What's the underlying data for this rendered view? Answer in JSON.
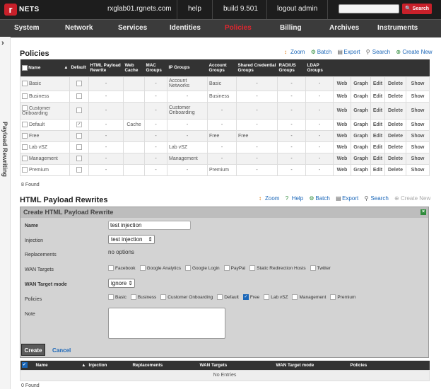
{
  "topbar": {
    "logo_letter": "r",
    "logo_text": "NETS",
    "host": "rxglab01.rgnets.com",
    "help": "help",
    "build": "build 9.501",
    "logout": "logout admin",
    "search_placeholder": "",
    "search_button": "Search"
  },
  "nav": [
    "System",
    "Network",
    "Services",
    "Identities",
    "Policies",
    "Billing",
    "Archives",
    "Instruments"
  ],
  "nav_active": "Policies",
  "sidebar": {
    "toggle": "›",
    "label": "Payload Rewriting"
  },
  "policies": {
    "title": "Policies",
    "actions": {
      "zoom": "Zoom",
      "batch": "Batch",
      "export": "Export",
      "search": "Search",
      "create": "Create New"
    },
    "headers": [
      "Name",
      "Default",
      "HTML Payload Rewrite",
      "Web Cache",
      "MAC Groups",
      "IP Groups",
      "Account Groups",
      "Shared Credential Groups",
      "RADIUS Groups",
      "LDAP Groups"
    ],
    "row_actions": [
      "Web",
      "Graph",
      "Edit",
      "Delete",
      "Show"
    ],
    "rows": [
      {
        "name": "Basic",
        "default": false,
        "rewrite": "-",
        "cache": "",
        "mac": "-",
        "ip": "Account Networks",
        "account": "Basic",
        "shared": "-",
        "radius": "-",
        "ldap": "-"
      },
      {
        "name": "Business",
        "default": false,
        "rewrite": "-",
        "cache": "",
        "mac": "-",
        "ip": "-",
        "account": "Business",
        "shared": "-",
        "radius": "-",
        "ldap": "-"
      },
      {
        "name": "Customer Onboarding",
        "default": false,
        "rewrite": "-",
        "cache": "",
        "mac": "-",
        "ip": "Customer Onboarding",
        "account": "-",
        "shared": "-",
        "radius": "-",
        "ldap": "-"
      },
      {
        "name": "Default",
        "default": true,
        "rewrite": "-",
        "cache": "Cache",
        "mac": "-",
        "ip": "-",
        "account": "-",
        "shared": "-",
        "radius": "-",
        "ldap": "-"
      },
      {
        "name": "Free",
        "default": false,
        "rewrite": "-",
        "cache": "",
        "mac": "-",
        "ip": "-",
        "account": "Free",
        "shared": "Free",
        "radius": "-",
        "ldap": "-"
      },
      {
        "name": "Lab vSZ",
        "default": false,
        "rewrite": "-",
        "cache": "",
        "mac": "-",
        "ip": "Lab vSZ",
        "account": "-",
        "shared": "-",
        "radius": "-",
        "ldap": "-"
      },
      {
        "name": "Management",
        "default": false,
        "rewrite": "-",
        "cache": "",
        "mac": "-",
        "ip": "Management",
        "account": "-",
        "shared": "-",
        "radius": "-",
        "ldap": "-"
      },
      {
        "name": "Premium",
        "default": false,
        "rewrite": "-",
        "cache": "",
        "mac": "-",
        "ip": "-",
        "account": "Premium",
        "shared": "-",
        "radius": "-",
        "ldap": "-"
      }
    ],
    "found": "8 Found"
  },
  "rewrites": {
    "title": "HTML Payload Rewrites",
    "actions": {
      "zoom": "Zoom",
      "help": "Help",
      "batch": "Batch",
      "export": "Export",
      "search": "Search",
      "create": "Create New"
    },
    "form": {
      "title": "Create HTML Payload Rewrite",
      "name_label": "Name",
      "name_value": "test injection",
      "injection_label": "Injection",
      "injection_value": "test injection",
      "replacements_label": "Replacements",
      "replacements_value": "no options",
      "wan_targets_label": "WAN Targets",
      "wan_targets": [
        {
          "label": "Facebook",
          "checked": false
        },
        {
          "label": "Google Analytics",
          "checked": false
        },
        {
          "label": "Google Login",
          "checked": false
        },
        {
          "label": "PayPal",
          "checked": false
        },
        {
          "label": "Static Redirection Hosts",
          "checked": false
        },
        {
          "label": "Twitter",
          "checked": false
        }
      ],
      "wan_mode_label": "WAN Target mode",
      "wan_mode_value": "ignore",
      "policies_label": "Policies",
      "policies": [
        {
          "label": "Basic",
          "checked": false
        },
        {
          "label": "Business",
          "checked": false
        },
        {
          "label": "Customer Onboarding",
          "checked": false
        },
        {
          "label": "Default",
          "checked": false
        },
        {
          "label": "Free",
          "checked": true
        },
        {
          "label": "Lab vSZ",
          "checked": false
        },
        {
          "label": "Management",
          "checked": false
        },
        {
          "label": "Premium",
          "checked": false
        }
      ],
      "note_label": "Note",
      "note_value": "",
      "create": "Create",
      "cancel": "Cancel"
    },
    "headers": [
      "Name",
      "Injection",
      "Replacements",
      "WAN Targets",
      "WAN Target mode",
      "Policies"
    ],
    "empty": "No Entries",
    "found": "0 Found"
  },
  "colors": {
    "accent_red": "#c8202a",
    "link_blue": "#1a66b8",
    "header_dark": "#333333"
  }
}
